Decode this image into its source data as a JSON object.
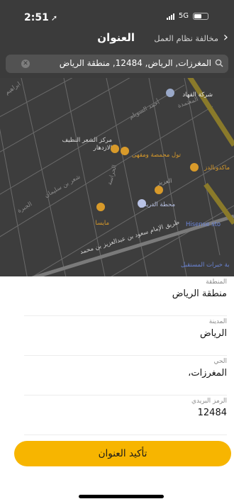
{
  "status_bar": {
    "time": "2:51",
    "network": "5G",
    "battery_level": 0.55
  },
  "nav": {
    "title": "العنوان",
    "link": "مخالفة نظام العمل"
  },
  "search": {
    "value": "المغرزات, الرياض, 12484, منطقة الرياض"
  },
  "map": {
    "pois": [
      {
        "name": "شركة القهاد",
        "color": "#e9e9e9"
      },
      {
        "name": "مركز الشعر النظيف الازدهار",
        "color": "#dcdcdc"
      },
      {
        "name": "تول محمصة ومقهى",
        "color": "#d89a2a"
      },
      {
        "name": "ماكدونالدز",
        "color": "#d89a2a"
      },
      {
        "name": "محطة الدريس",
        "color": "#b9c3e6"
      },
      {
        "name": "مايسا",
        "color": "#d89a2a"
      },
      {
        "name": "Hisense sto",
        "color": "#6c86d9"
      },
      {
        "name": "بة خبرات المستقبل",
        "color": "#6c86d9"
      }
    ],
    "streets": [
      "ابراهيم",
      "طريق الإمام سعود بن عبدالعزيز بن محمد",
      "العزيز",
      "شعر بن سليمان",
      "أحمد السويلم",
      "الجبرة",
      "الحراسة",
      "المعتمدة"
    ]
  },
  "fields": [
    {
      "label": "المنطقة",
      "value": "منطقة الرياض"
    },
    {
      "label": "المدينة",
      "value": "الرياض"
    },
    {
      "label": "الحي",
      "value": "المغرزات،"
    },
    {
      "label": "الرمز البريدي",
      "value": "12484"
    }
  ],
  "confirm_label": "تأكيد العنوان",
  "colors": {
    "accent": "#f7b500",
    "overlay": "#3b3b3b"
  }
}
